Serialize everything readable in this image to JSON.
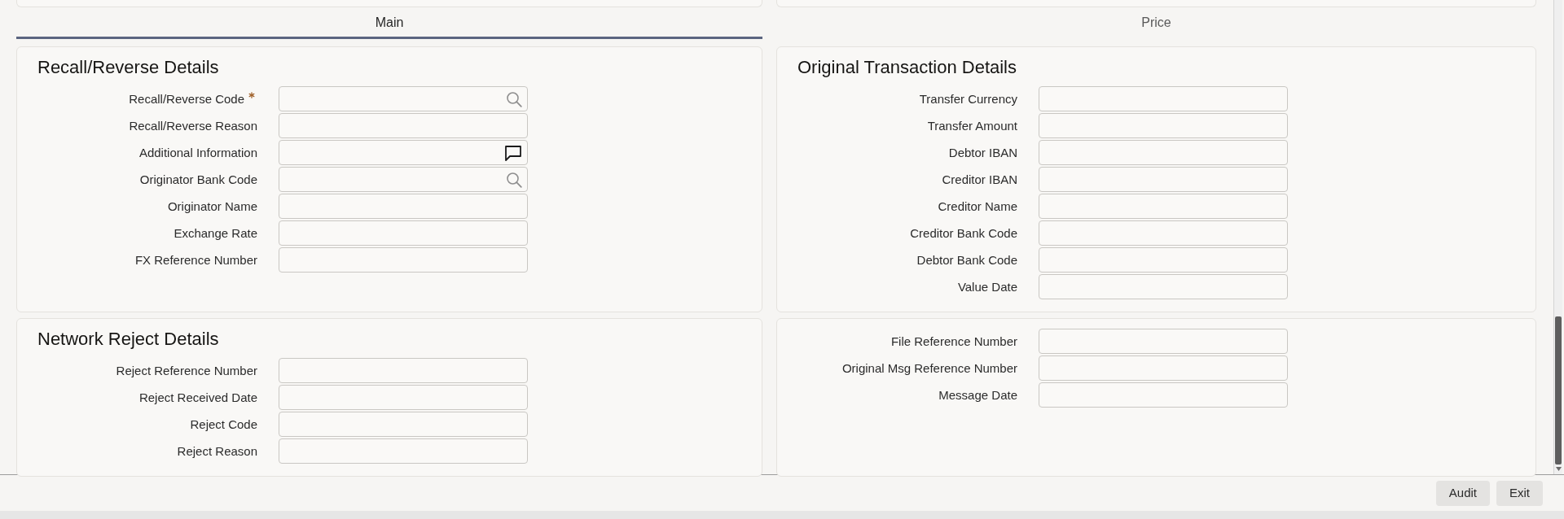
{
  "tabs": [
    {
      "label": "Main",
      "selected": true
    },
    {
      "label": "Price",
      "selected": false
    }
  ],
  "sections": [
    {
      "title": "Recall/Reverse Details",
      "fields": [
        {
          "label": "Recall/Reverse Code",
          "kind": "search",
          "required": true
        },
        {
          "label": "Recall/Reverse Reason",
          "kind": "text",
          "required": false
        },
        {
          "label": "Additional Information",
          "kind": "comment",
          "required": false
        },
        {
          "label": "Originator Bank Code",
          "kind": "search",
          "required": false
        },
        {
          "label": "Originator Name",
          "kind": "text",
          "required": false
        },
        {
          "label": "Exchange Rate",
          "kind": "text",
          "required": false
        },
        {
          "label": "FX Reference Number",
          "kind": "text",
          "required": false
        }
      ]
    },
    {
      "title": "Original Transaction Details",
      "fields": [
        {
          "label": "Transfer Currency",
          "kind": "text",
          "required": false
        },
        {
          "label": "Transfer Amount",
          "kind": "text",
          "required": false
        },
        {
          "label": "Debtor IBAN",
          "kind": "text",
          "required": false
        },
        {
          "label": "Creditor IBAN",
          "kind": "text",
          "required": false
        },
        {
          "label": "Creditor Name",
          "kind": "text",
          "required": false
        },
        {
          "label": "Creditor Bank Code",
          "kind": "text",
          "required": false
        },
        {
          "label": "Debtor Bank Code",
          "kind": "text",
          "required": false
        },
        {
          "label": "Value Date",
          "kind": "text",
          "required": false
        }
      ]
    },
    {
      "title": "Network Reject Details",
      "fields": [
        {
          "label": "Reject Reference Number",
          "kind": "text",
          "required": false
        },
        {
          "label": "Reject Received Date",
          "kind": "text",
          "required": false
        },
        {
          "label": "Reject Code",
          "kind": "text",
          "required": false
        },
        {
          "label": "Reject Reason",
          "kind": "text",
          "required": false
        }
      ]
    },
    {
      "fields": [
        {
          "label": "File Reference Number",
          "kind": "text",
          "required": false
        },
        {
          "label": "Original Msg Reference Number",
          "kind": "text",
          "required": false
        },
        {
          "label": "Message Date",
          "kind": "text",
          "required": false
        }
      ]
    }
  ],
  "buttons": [
    "Audit",
    "Exit"
  ]
}
